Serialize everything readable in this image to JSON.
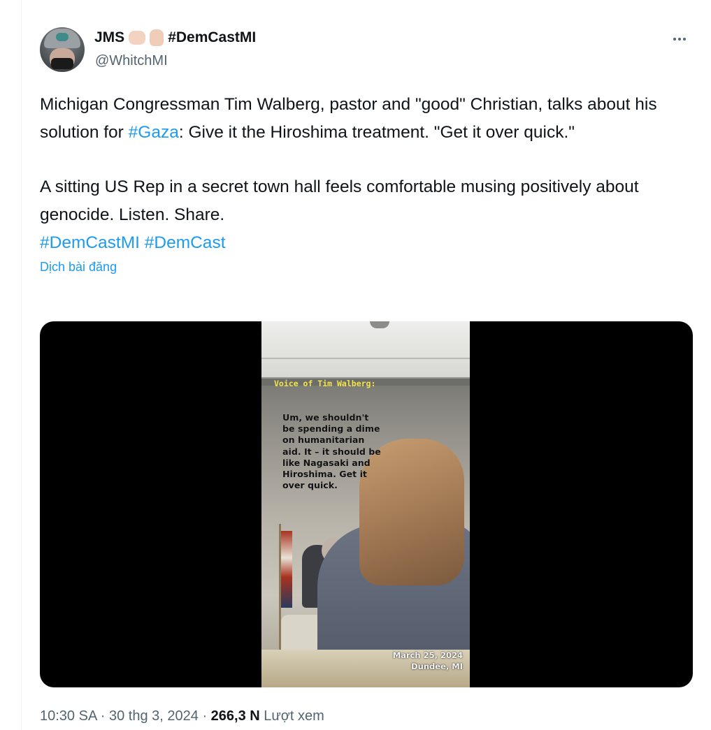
{
  "user": {
    "display_name": "JMS",
    "name_suffix": "#DemCastMI",
    "handle": "@WhitchMI",
    "emojis": [
      "pointing-hand-emoji",
      "raised-hand-emoji"
    ]
  },
  "tweet": {
    "line1_prefix": "Michigan Congressman Tim Walberg, pastor and \"good\" Christian, talks about his solution for ",
    "line1_hashtag": "#Gaza",
    "line1_suffix": ": Give it the Hiroshima treatment. \"Get it over quick.\"",
    "para2": "A sitting US Rep in a secret town hall feels comfortable musing positively about genocide. Listen. Share.",
    "hashtags": [
      "#DemCastMI",
      "#DemCast"
    ],
    "translate": "Dịch bài đăng"
  },
  "video": {
    "caption_title": "Voice of Tim Walberg:",
    "quote_lines": [
      "Um, we shouldn't",
      "be spending a dime",
      "on humanitarian",
      "aid. It – it should be",
      "like Nagasaki and",
      "Hiroshima. Get it",
      "over quick."
    ],
    "date": "March 25, 2024",
    "location": "Dundee, MI"
  },
  "meta": {
    "time": "10:30 SA",
    "date": "30 thg 3, 2024",
    "views_count": "266,3 N",
    "views_label": "Lượt xem"
  },
  "icons": {
    "more": "more-options-icon"
  }
}
